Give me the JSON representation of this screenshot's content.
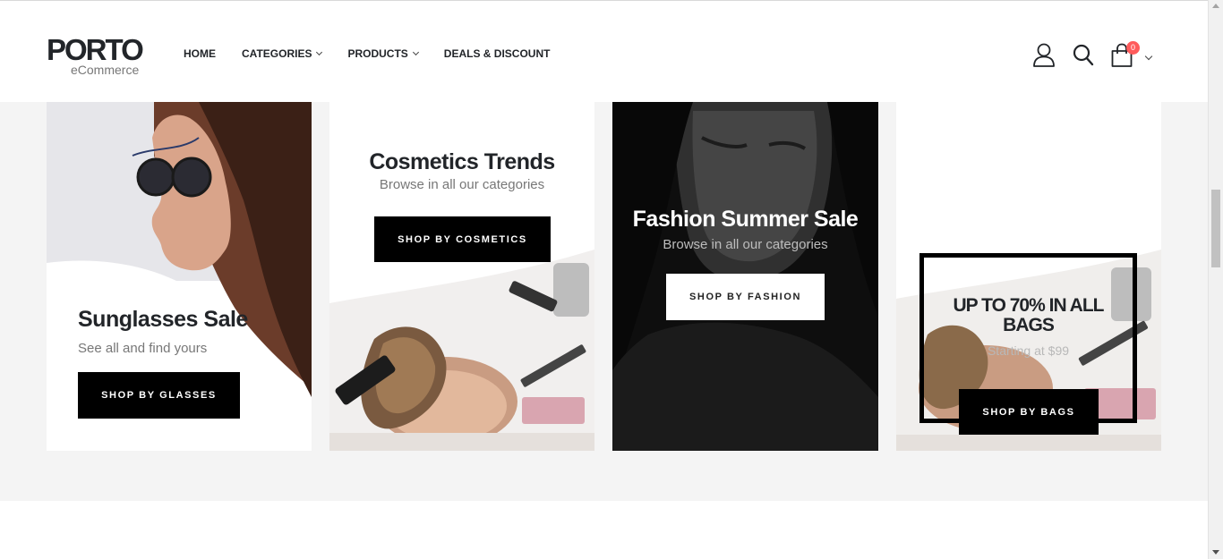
{
  "header": {
    "logo": {
      "main": "PORTO",
      "sub": "eCommerce"
    },
    "nav": [
      {
        "label": "HOME",
        "dropdown": false
      },
      {
        "label": "CATEGORIES",
        "dropdown": true
      },
      {
        "label": "PRODUCTS",
        "dropdown": true
      },
      {
        "label": "DEALS & DISCOUNT",
        "dropdown": false
      }
    ],
    "icons": {
      "account": "user-icon",
      "search": "search-icon",
      "cart": "shopping-bag-icon"
    },
    "cart_count": "0"
  },
  "banners": [
    {
      "title": "Sunglasses Sale",
      "subtitle": "See all and find yours",
      "button": "SHOP BY GLASSES"
    },
    {
      "title": "Cosmetics Trends",
      "subtitle": "Browse in all our categories",
      "button": "SHOP BY COSMETICS"
    },
    {
      "title": "Fashion Summer Sale",
      "subtitle": "Browse in all our categories",
      "button": "SHOP BY FASHION"
    },
    {
      "title": "UP TO 70% IN ALL BAGS",
      "subtitle": "Starting at $99",
      "button": "SHOP BY BAGS"
    }
  ],
  "colors": {
    "accent": "#ff5b5b",
    "dark": "#222529",
    "section_bg": "#f4f4f4"
  }
}
